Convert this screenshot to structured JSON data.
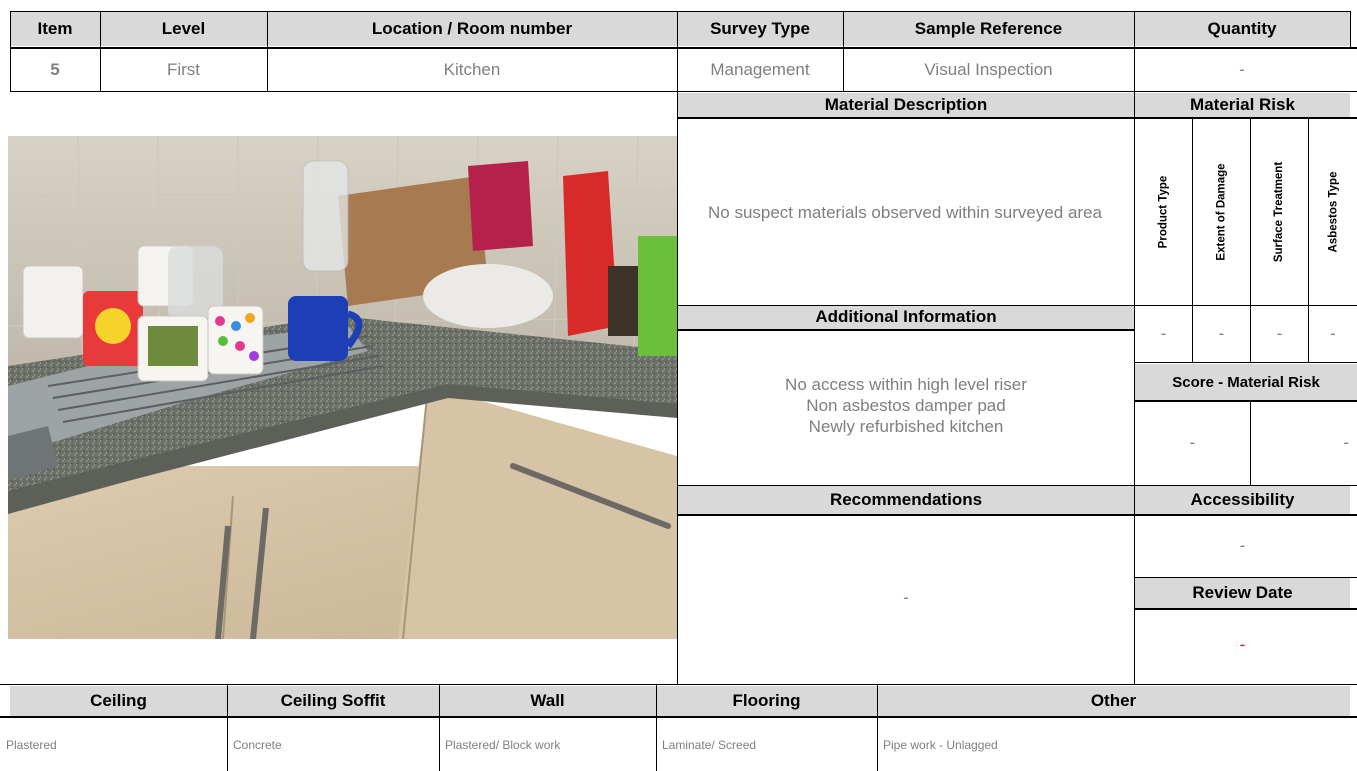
{
  "header": {
    "item": "Item",
    "level": "Level",
    "location": "Location / Room number",
    "survey_type": "Survey Type",
    "sample_reference": "Sample Reference",
    "quantity": "Quantity"
  },
  "row": {
    "item": "5",
    "level": "First",
    "location": "Kitchen",
    "survey_type": "Management",
    "sample_reference": "Visual Inspection",
    "quantity": "-"
  },
  "material_description": {
    "title": "Material Description",
    "text": "No suspect materials observed within surveyed area"
  },
  "material_risk": {
    "title": "Material Risk",
    "columns": [
      "Product Type",
      "Extent of Damage",
      "Surface Treatment",
      "Asbestos Type"
    ],
    "values": [
      "-",
      "-",
      "-",
      "-"
    ]
  },
  "additional_information": {
    "title": "Additional Information",
    "lines": [
      "No access within high level riser",
      "Non asbestos damper pad",
      "Newly refurbished kitchen"
    ]
  },
  "score": {
    "title": "Score - Material Risk",
    "values": [
      "-",
      "-"
    ]
  },
  "recommendations": {
    "title": "Recommendations",
    "text": "-"
  },
  "accessibility": {
    "title": "Accessibility",
    "value": "-"
  },
  "review_date": {
    "title": "Review Date",
    "value": "-",
    "value_color": "#ff0000"
  },
  "footer": {
    "headers": [
      "Ceiling",
      "Ceiling Soffit",
      "Wall",
      "Flooring",
      "Other"
    ],
    "values": [
      "Plastered",
      "Concrete",
      "Plastered/ Block work",
      "Laminate/ Screed",
      "Pipe work - Unlagged"
    ]
  },
  "colors": {
    "header_bg": "#d9d9d9",
    "value_text": "#7f7f7f",
    "grid": "#000000"
  }
}
